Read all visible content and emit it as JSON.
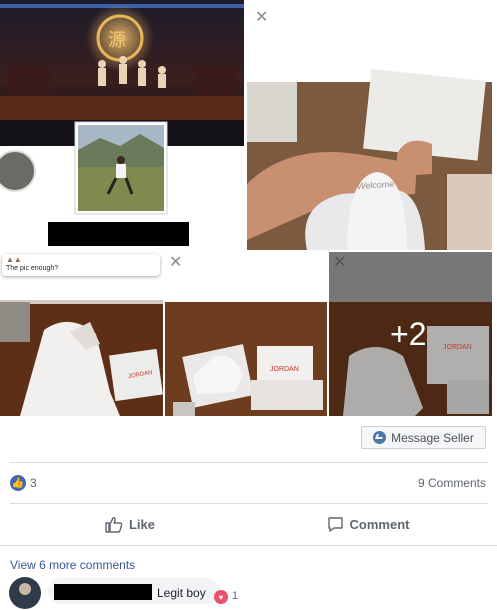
{
  "photos": {
    "stage_sign": "源",
    "sticker_caption": "The pic enough?",
    "tongue_text": "Welcome",
    "more_count": "+2",
    "box_brand": "JORDAN"
  },
  "actions": {
    "message_seller": "Message Seller",
    "like": "Like",
    "comment": "Comment"
  },
  "stats": {
    "reactions_count": "3",
    "comments_count": "9 Comments"
  },
  "comments": {
    "view_more": "View 6 more comments",
    "first_comment_text": "Legit boy",
    "first_comment_reactions": "1"
  },
  "colors": {
    "accent": "#4267b2",
    "stage_dark": "#1a1214",
    "floor_wood": "#6b3a1f"
  }
}
